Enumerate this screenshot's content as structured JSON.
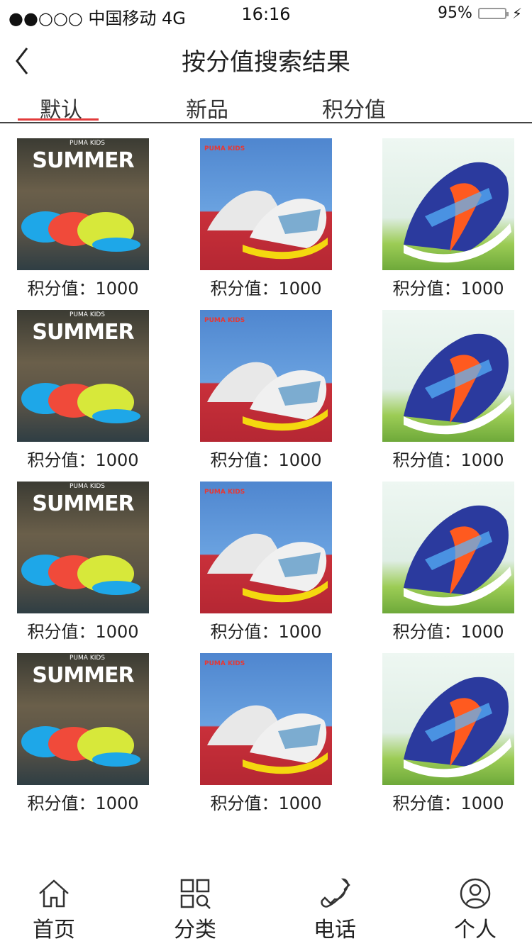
{
  "status_bar": {
    "carrier": "●●○○○ 中国移动 4G",
    "time": "16:16",
    "battery_text": "95%",
    "battery_level": 0.95,
    "battery_color": "#3ac44b"
  },
  "nav": {
    "title": "按分值搜索结果",
    "back_icon": "chevron-left-icon"
  },
  "tabs": [
    {
      "label": "默认",
      "active": true
    },
    {
      "label": "新品",
      "active": false
    },
    {
      "label": "积分值",
      "active": false
    }
  ],
  "accent_color": "#e23b3b",
  "products": [
    [
      {
        "image": "summer-sandals",
        "banner": "SUMMER",
        "brand": "PUMA",
        "sub": "KIDS",
        "price": "积分值：1000"
      },
      {
        "image": "white-sneakers",
        "brand": "PUMA",
        "sub": "KIDS",
        "price": "积分值：1000"
      },
      {
        "image": "blue-orange-sneaker",
        "price": "积分值：1000"
      }
    ],
    [
      {
        "image": "summer-sandals",
        "banner": "SUMMER",
        "brand": "PUMA",
        "sub": "KIDS",
        "price": "积分值：1000"
      },
      {
        "image": "white-sneakers",
        "brand": "PUMA",
        "sub": "KIDS",
        "price": "积分值：1000"
      },
      {
        "image": "blue-orange-sneaker",
        "price": "积分值：1000"
      }
    ],
    [
      {
        "image": "summer-sandals",
        "banner": "SUMMER",
        "brand": "PUMA",
        "sub": "KIDS",
        "price": "积分值：1000"
      },
      {
        "image": "white-sneakers",
        "brand": "PUMA",
        "sub": "KIDS",
        "price": "积分值：1000"
      },
      {
        "image": "blue-orange-sneaker",
        "price": "积分值：1000"
      }
    ],
    [
      {
        "image": "summer-sandals",
        "banner": "SUMMER",
        "brand": "PUMA",
        "sub": "KIDS",
        "price": "积分值：1000"
      },
      {
        "image": "white-sneakers",
        "brand": "PUMA",
        "sub": "KIDS",
        "price": "积分值：1000"
      },
      {
        "image": "blue-orange-sneaker",
        "price": "积分值：1000"
      }
    ]
  ],
  "tabbar": [
    {
      "label": "首页",
      "icon": "home-icon"
    },
    {
      "label": "分类",
      "icon": "category-icon"
    },
    {
      "label": "电话",
      "icon": "phone-icon"
    },
    {
      "label": "个人",
      "icon": "user-icon"
    }
  ]
}
